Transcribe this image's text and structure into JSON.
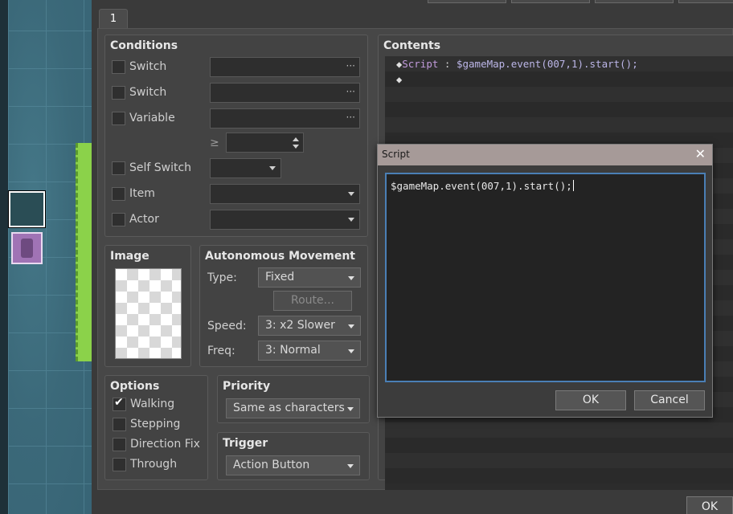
{
  "tab": {
    "label": "1"
  },
  "conditions": {
    "title": "Conditions",
    "switch1_label": "Switch",
    "switch2_label": "Switch",
    "variable_label": "Variable",
    "compare_symbol": "≥",
    "self_switch_label": "Self Switch",
    "item_label": "Item",
    "actor_label": "Actor",
    "dots": "···"
  },
  "image": {
    "title": "Image"
  },
  "movement": {
    "title": "Autonomous Movement",
    "type_label": "Type:",
    "type_value": "Fixed",
    "route_label": "Route...",
    "speed_label": "Speed:",
    "speed_value": "3: x2 Slower",
    "freq_label": "Freq:",
    "freq_value": "3: Normal"
  },
  "options": {
    "title": "Options",
    "walking": "Walking",
    "stepping": "Stepping",
    "direction_fix": "Direction Fix",
    "through": "Through"
  },
  "priority": {
    "title": "Priority",
    "value": "Same as characters"
  },
  "trigger": {
    "title": "Trigger",
    "value": "Action Button"
  },
  "contents": {
    "title": "Contents",
    "line1_diamond": "◆",
    "line1_cmd": "Script",
    "line1_sep": " : ",
    "line1_code": "$gameMap.event(007,1).start();",
    "line2_diamond": "◆"
  },
  "script_dialog": {
    "title": "Script",
    "close": "✕",
    "text": "$gameMap.event(007,1).start();",
    "ok": "OK",
    "cancel": "Cancel"
  },
  "footer": {
    "ok": "OK"
  }
}
